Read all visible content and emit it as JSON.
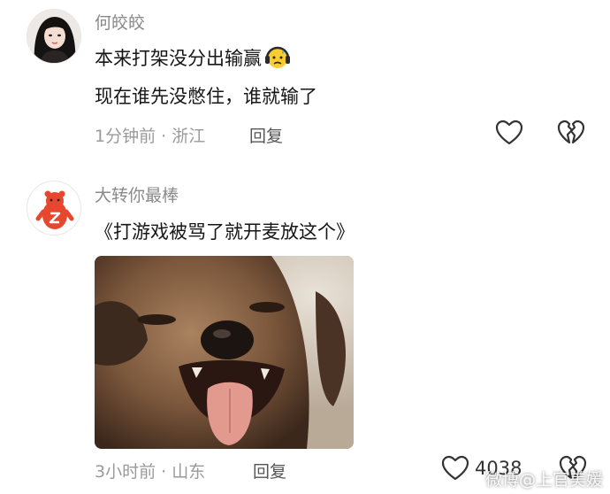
{
  "comments": [
    {
      "username": "何皎皎",
      "lines": [
        "本来打架没分出输赢",
        "现在谁先没憋住，谁就输了"
      ],
      "inline_emoji": "sweating-headphones-face-emoji",
      "time": "1分钟前",
      "separator": "·",
      "location": "浙江",
      "reply_label": "回复",
      "like_count": "",
      "icons": [
        "heart-outline-icon",
        "broken-heart-icon"
      ]
    },
    {
      "username": "大转你最棒",
      "lines": [
        "《打游戏被骂了就开麦放这个》"
      ],
      "image": "dog-meme-photo",
      "time": "3小时前",
      "separator": "·",
      "location": "山东",
      "reply_label": "回复",
      "like_count": "4038",
      "icons": [
        "heart-outline-icon",
        "broken-heart-icon"
      ]
    }
  ],
  "watermark": "微博@上官美媛",
  "colors": {
    "username": "#8a8a8a",
    "text": "#161616",
    "meta": "#9a9a9a",
    "icon_stroke": "#333333"
  }
}
